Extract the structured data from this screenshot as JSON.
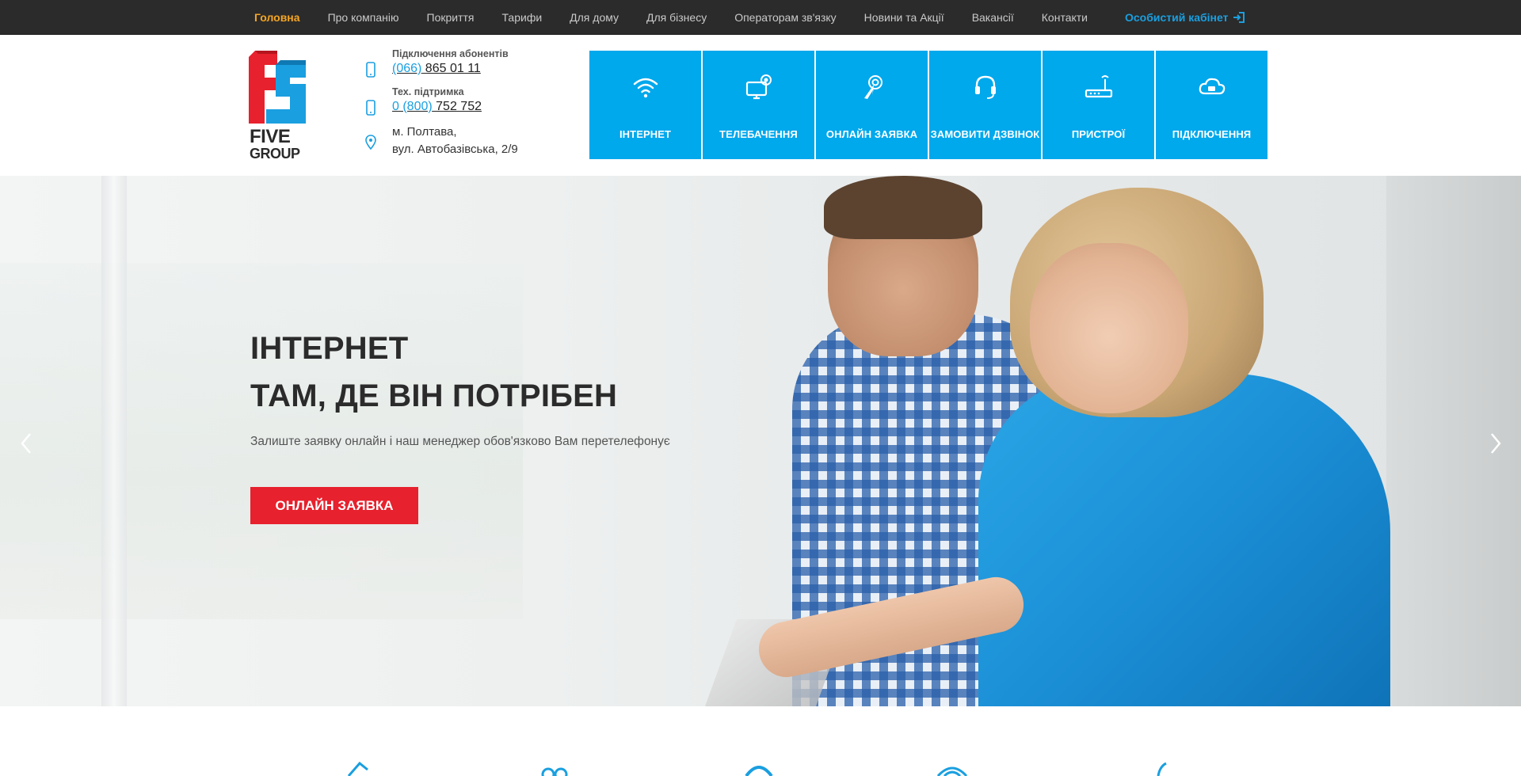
{
  "nav": {
    "items": [
      {
        "label": "Головна",
        "active": true
      },
      {
        "label": "Про компанію"
      },
      {
        "label": "Покриття"
      },
      {
        "label": "Тарифи"
      },
      {
        "label": "Для дому"
      },
      {
        "label": "Для бізнесу"
      },
      {
        "label": "Операторам зв'язку"
      },
      {
        "label": "Новини та Акції"
      },
      {
        "label": "Вакансії"
      },
      {
        "label": "Контакти"
      }
    ],
    "cabinet_label": "Особистий кабінет",
    "active_color": "#f5a623",
    "cabinet_color": "#1a9fe0"
  },
  "logo": {
    "word1": "FIVE",
    "word2": "GROUP",
    "red": "#e7212d",
    "blue": "#1a9fe0"
  },
  "contacts": {
    "connection_label": "Підключення абонентів",
    "connection_code": "(066)",
    "connection_number": " 865 01 11",
    "support_label": "Тех. підтримка",
    "support_code": "0 (800)",
    "support_number": " 752 752",
    "address_line1": "м. Полтава,",
    "address_line2": "вул. Автобазівська, 2/9"
  },
  "tiles": [
    {
      "label": "ІНТЕРНЕТ",
      "icon": "wifi-icon"
    },
    {
      "label": "ТЕЛЕБАЧЕННЯ",
      "icon": "tv-icon"
    },
    {
      "label": "ОНЛАЙН ЗАЯВКА",
      "icon": "click-icon"
    },
    {
      "label": "ЗАМОВИТИ ДЗВІНОК",
      "icon": "headset-icon"
    },
    {
      "label": "ПРИСТРОЇ",
      "icon": "router-icon"
    },
    {
      "label": "ПІДКЛЮЧЕННЯ",
      "icon": "cloud-icon"
    }
  ],
  "tile_color": "#00a8ec",
  "hero": {
    "title_line1": "ІНТЕРНЕТ",
    "title_line2": "ТАМ, ДЕ ВІН ПОТРІБЕН",
    "subtitle": "Залиште заявку онлайн і наш менеджер обов'язково Вам перетелефонує",
    "cta_label": "ОНЛАЙН ЗАЯВКА",
    "cta_color": "#e7212d"
  }
}
